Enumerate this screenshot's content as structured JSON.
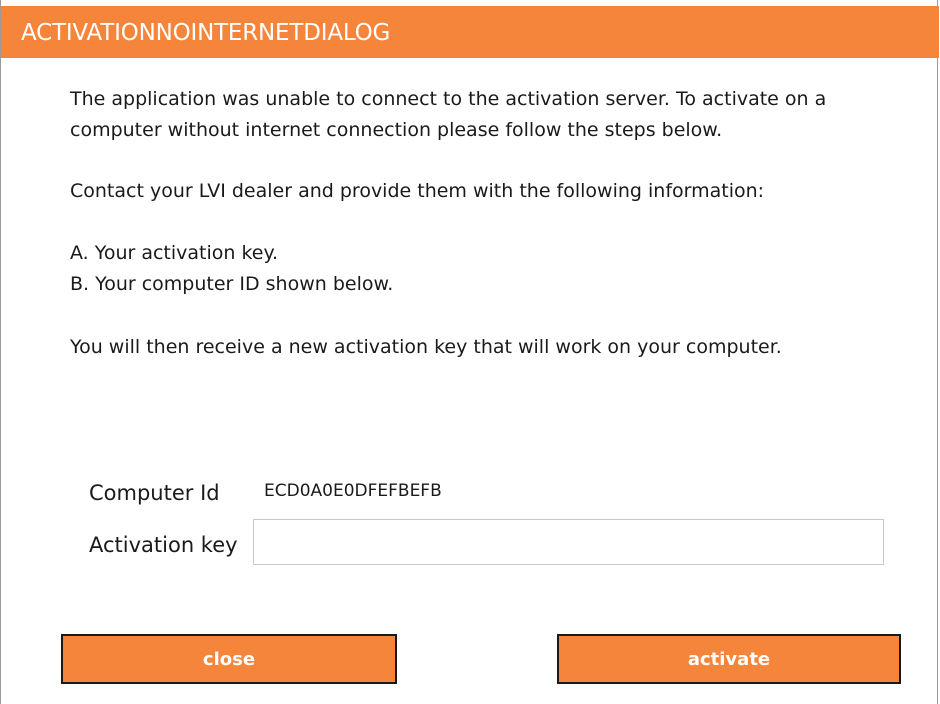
{
  "window": {
    "title": "ACTIVATIONNOINTERNETDIALOG"
  },
  "message": {
    "line1": "The application was unable to connect to the activation server. To activate on a",
    "line2": "computer without internet connection please follow the steps below.",
    "line3": "Contact your LVI dealer and provide them with the following information:",
    "step_a": "A. Your activation key.",
    "step_b": "B. Your computer ID shown below.",
    "line4": "You will then receive a new activation key that will work on your computer."
  },
  "form": {
    "computer_id_label": "Computer Id",
    "computer_id_value": "ECD0A0E0DFEFBEFB",
    "activation_key_label": "Activation key",
    "activation_key_value": "",
    "activation_key_placeholder": ""
  },
  "buttons": {
    "close_label": "close",
    "activate_label": "activate"
  },
  "colors": {
    "accent": "#f5853a",
    "text": "#1a1a1a",
    "button_text": "#ffffff"
  }
}
